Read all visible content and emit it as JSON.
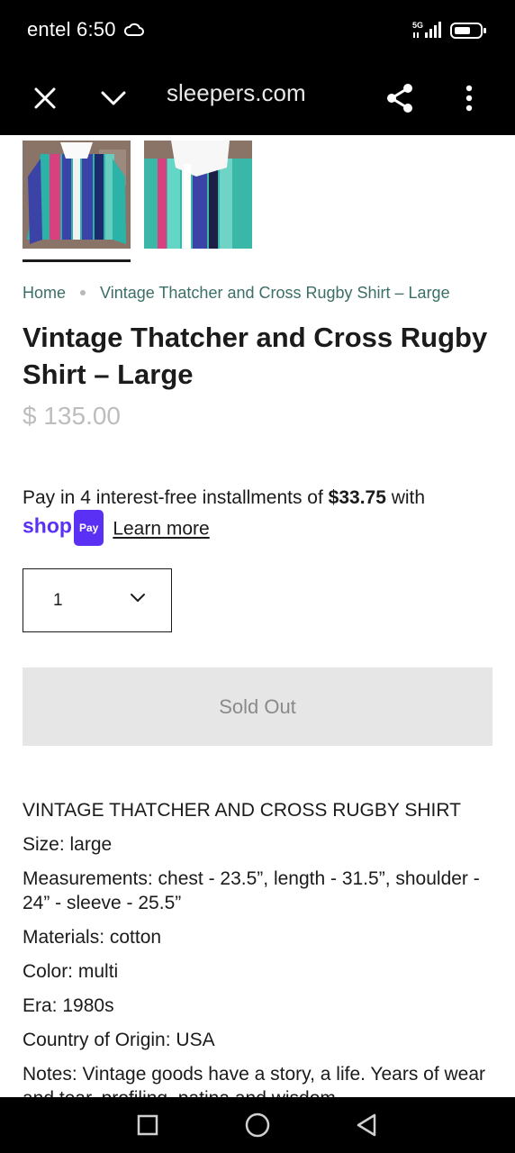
{
  "status_bar": {
    "carrier": "entel",
    "time": "6:50",
    "network": "5G"
  },
  "browser": {
    "url": "sleepers.com"
  },
  "breadcrumb": {
    "home": "Home",
    "current": "Vintage Thatcher and Cross Rugby Shirt – Large"
  },
  "product": {
    "title": "Vintage Thatcher and Cross Rugby Shirt – Large",
    "price": "$ 135.00",
    "installments_text": "Pay in 4 interest-free installments of ",
    "installment_amount": "$33.75",
    "installments_suffix": " with",
    "shop_word": "shop",
    "shop_pay_chip": "Pay",
    "learn_more": "Learn more",
    "quantity": "1",
    "sold_out_label": "Sold Out"
  },
  "description": [
    "VINTAGE THATCHER AND CROSS RUGBY SHIRT",
    "Size: large",
    "Measurements: chest - 23.5”, length - 31.5”, shoulder - 24” - sleeve - 25.5”",
    "Materials: cotton",
    "Color: multi",
    "Era: 1980s",
    "Country of Origin: USA",
    "Notes: Vintage goods have a story, a life. Years of wear and tear, profiling, patina and wisdom."
  ],
  "colors": {
    "shop_pay": "#5a31f4",
    "breadcrumb_link": "#3b6e66",
    "sold_out_bg": "#e6e6e6"
  }
}
